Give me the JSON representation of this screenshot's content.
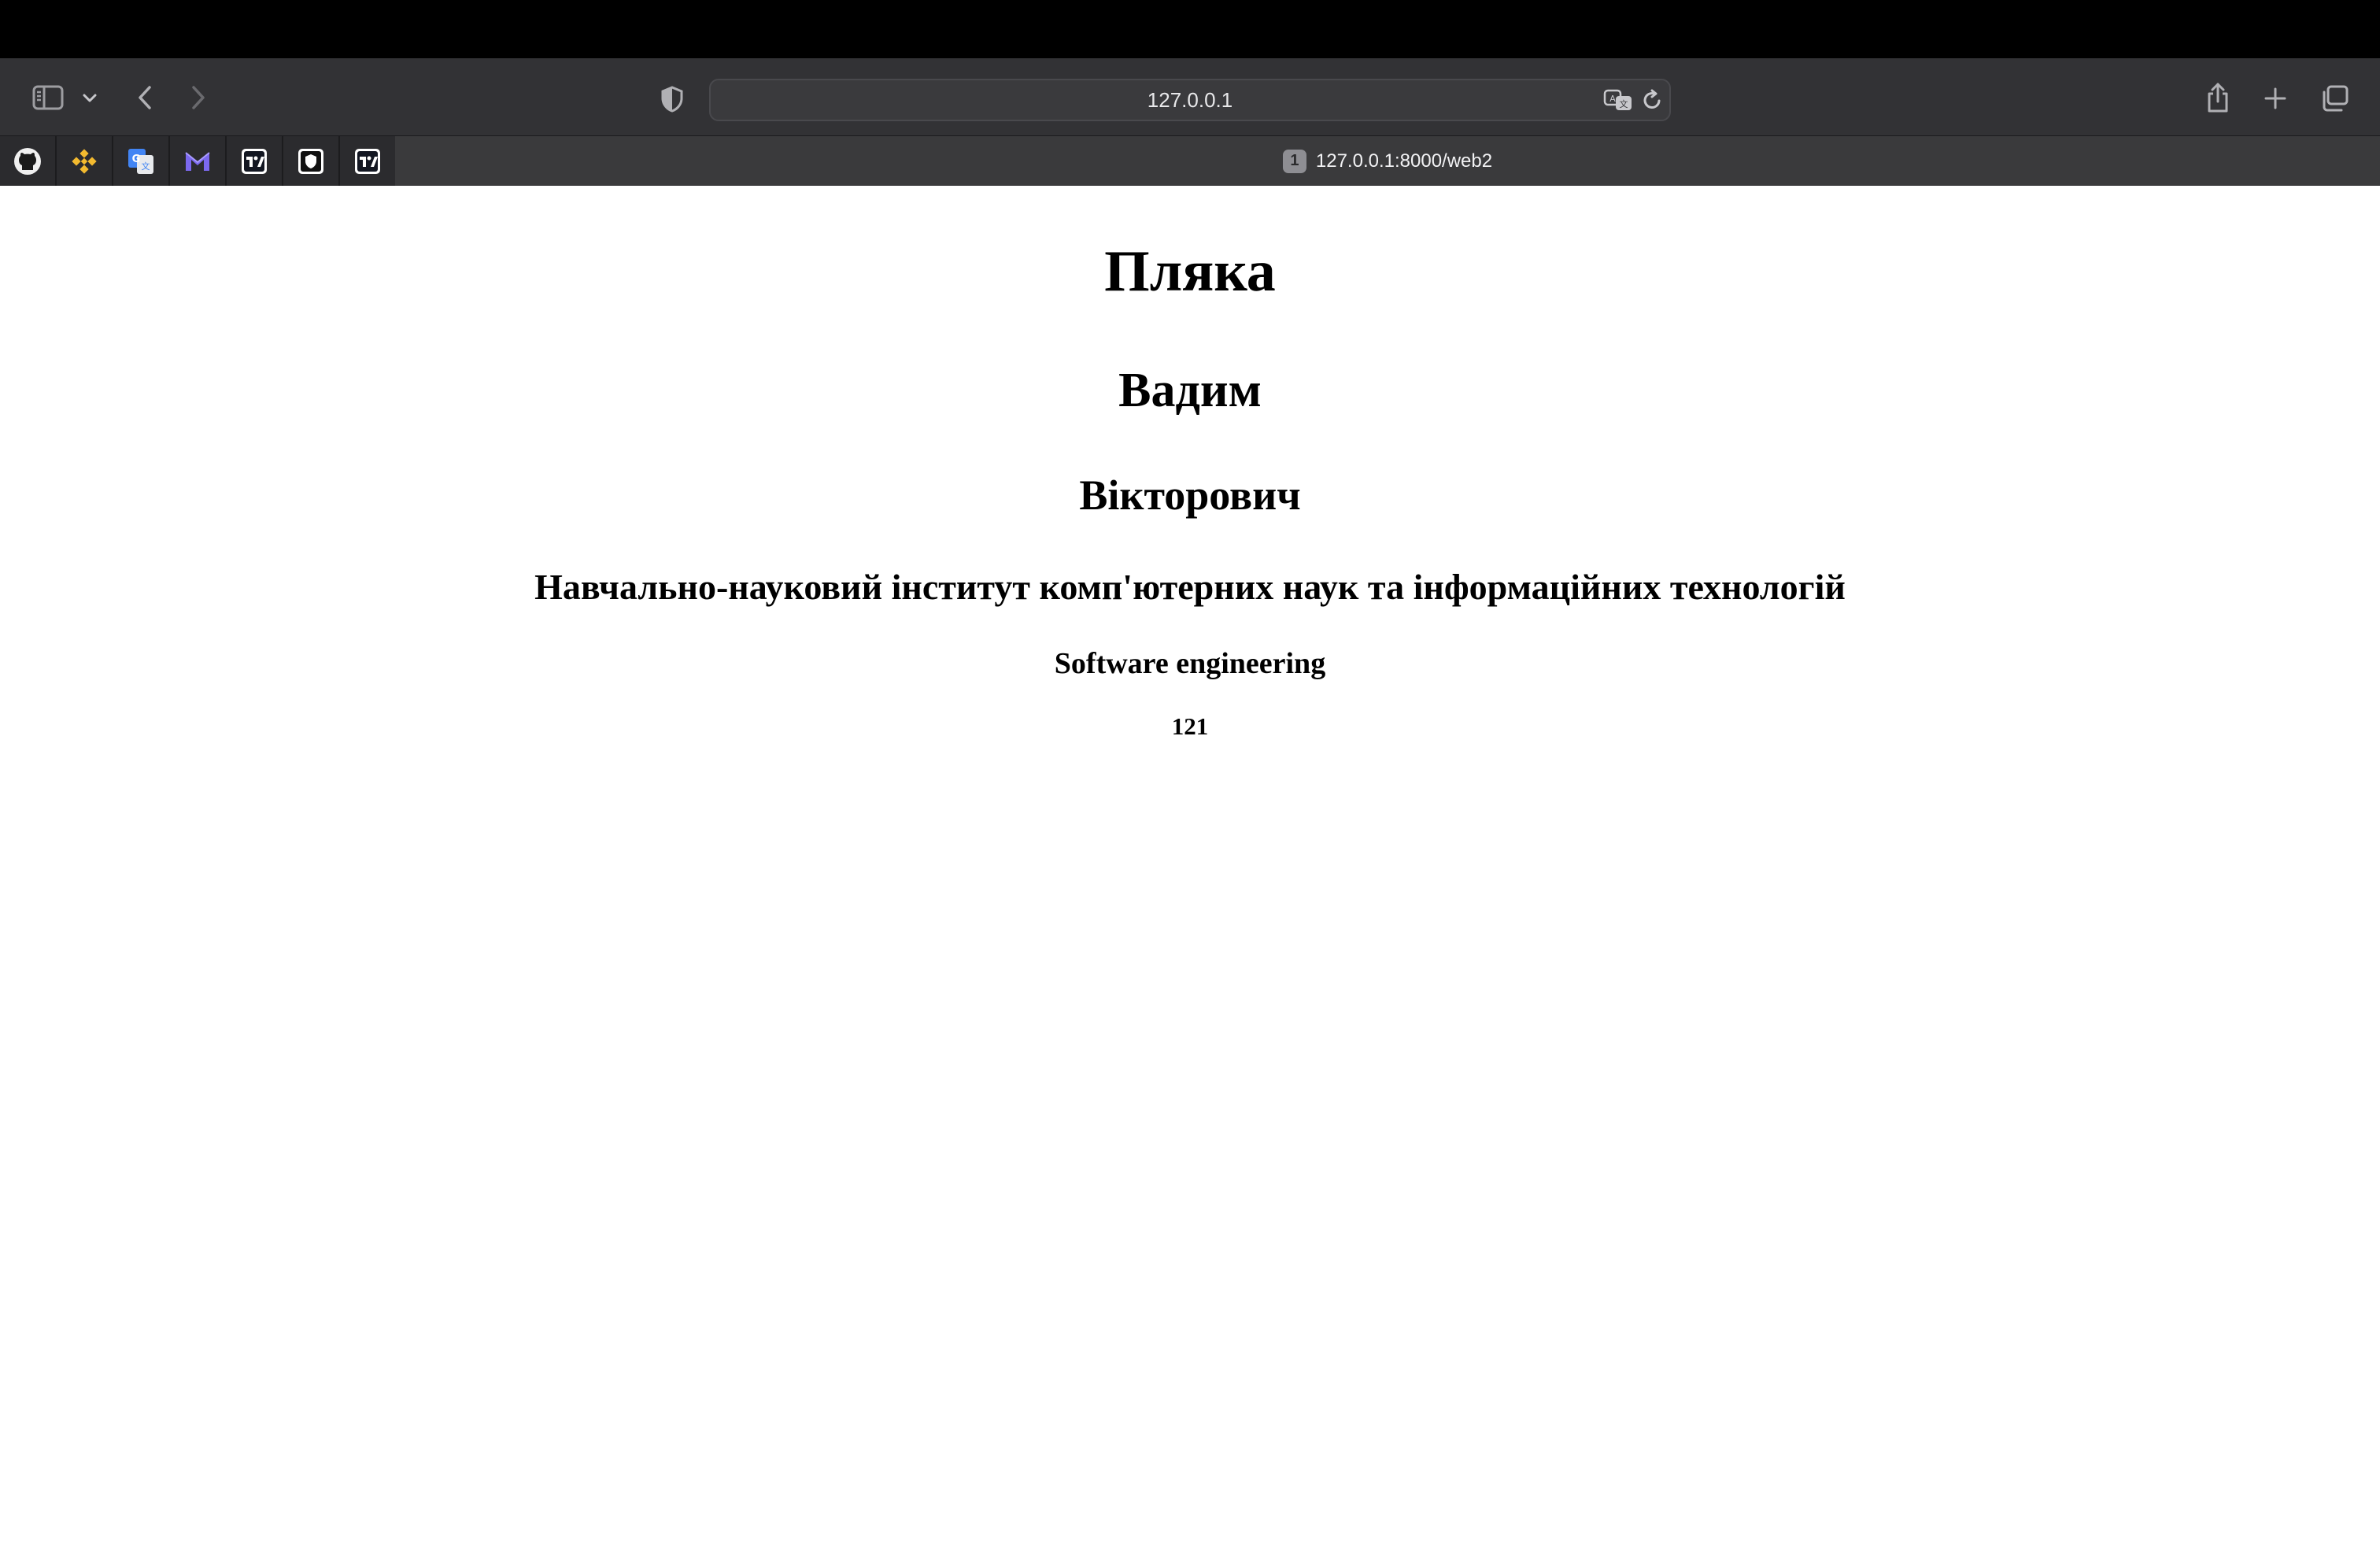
{
  "browser": {
    "address_bar": {
      "text": "127.0.0.1"
    },
    "toolbar_icons": [
      "sidebar-icon",
      "chevron-down-icon",
      "back-icon",
      "forward-icon",
      "privacy-shield-icon",
      "translate-icon",
      "reload-icon",
      "share-icon",
      "new-tab-icon",
      "tab-overview-icon"
    ],
    "pinned_tabs": [
      "github-icon",
      "binance-icon",
      "google-translate-icon",
      "mail-icon",
      "tradingview-icon",
      "shield-app-icon",
      "tradingview-icon"
    ],
    "active_tab": {
      "badge": "1",
      "title": "127.0.0.1:8000/web2"
    }
  },
  "page": {
    "h1": "Пляка",
    "h2": "Вадим",
    "h3": "Вікторович",
    "h4": "Навчально-науковий інститут комп'ютерних наук та інформаційних технологій",
    "h5": "Software engineering",
    "h6": "121"
  },
  "colors": {
    "toolbar_bg": "#323235",
    "tabbar_bg": "#262628",
    "active_tab_bg": "#3a3a3c",
    "page_bg": "#ffffff",
    "page_text": "#000000"
  }
}
